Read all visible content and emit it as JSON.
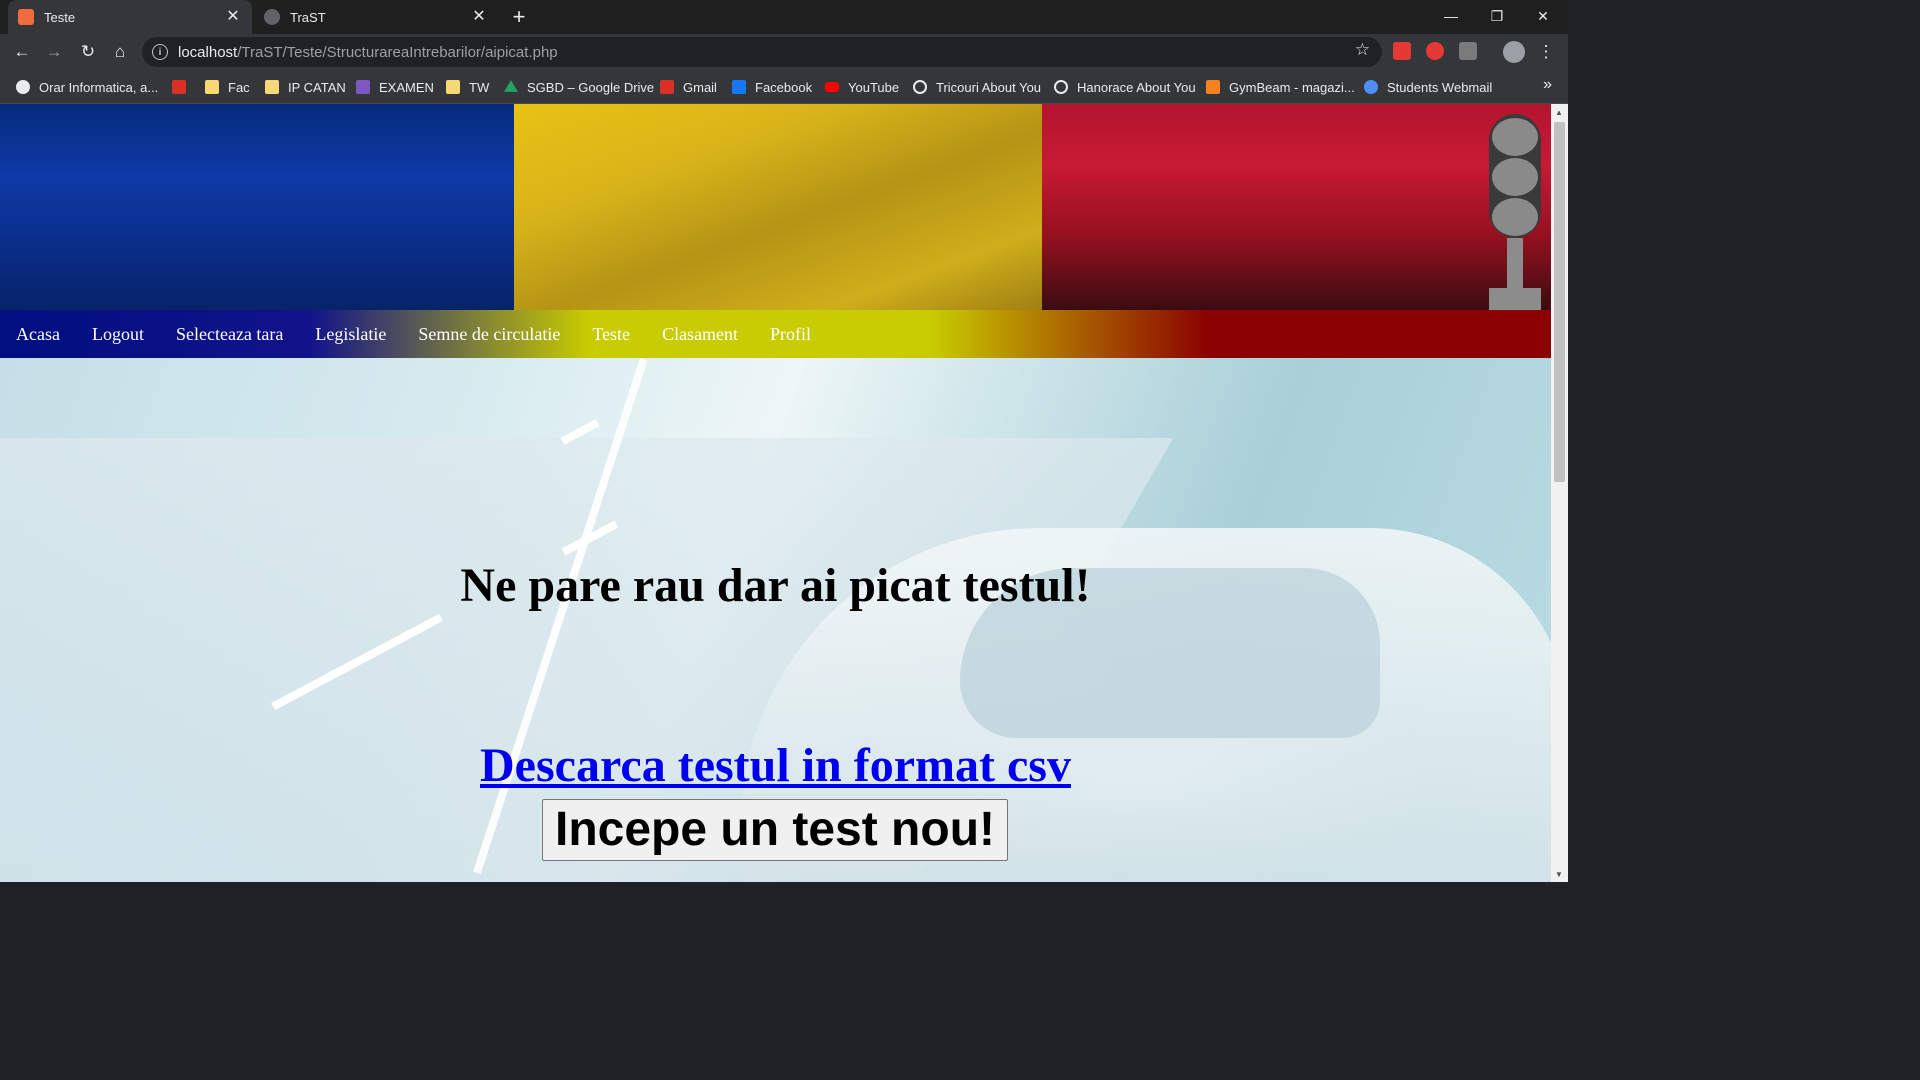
{
  "browser": {
    "tabs": [
      {
        "title": "Teste",
        "active": true,
        "favicon_color": "#f06c3c"
      },
      {
        "title": "TraST",
        "active": false,
        "favicon_color": "#5f6368"
      }
    ],
    "url": {
      "host": "localhost",
      "path": "/TraST/Teste/StructurareaIntrebarilor/aipicat.php"
    },
    "bookmarks": [
      {
        "label": "Orar Informatica, a...",
        "icon": "globe-icon",
        "color": "#e8eaed"
      },
      {
        "label": "",
        "icon": "gmail-icon",
        "color": "#d93025"
      },
      {
        "label": "Fac",
        "icon": "folder-icon",
        "color": "#f8d775"
      },
      {
        "label": "IP CATAN",
        "icon": "folder-icon",
        "color": "#f8d775"
      },
      {
        "label": "EXAMEN",
        "icon": "list-icon",
        "color": "#7e57c2"
      },
      {
        "label": "TW",
        "icon": "folder-icon",
        "color": "#f8d775"
      },
      {
        "label": "SGBD – Google Drive",
        "icon": "drive-icon",
        "color": "#1fa463"
      },
      {
        "label": "Gmail",
        "icon": "gmail-icon",
        "color": "#d93025"
      },
      {
        "label": "Facebook",
        "icon": "facebook-icon",
        "color": "#1877f2"
      },
      {
        "label": "YouTube",
        "icon": "youtube-icon",
        "color": "#ff0000"
      },
      {
        "label": "Tricouri About You",
        "icon": "circle-icon",
        "color": "#e8eaed"
      },
      {
        "label": "Hanorace About You",
        "icon": "circle-icon",
        "color": "#e8eaed"
      },
      {
        "label": "GymBeam - magazi...",
        "icon": "gymbeam-icon",
        "color": "#f5821f"
      },
      {
        "label": "Students Webmail",
        "icon": "webmail-icon",
        "color": "#4f8ef7"
      }
    ],
    "bookmarks_more": "»"
  },
  "site": {
    "menu": [
      "Acasa",
      "Logout",
      "Selecteaza tara",
      "Legislatie",
      "Semne de circulatie",
      "Teste",
      "Clasament",
      "Profil"
    ],
    "message": "Ne pare rau dar ai picat testul!",
    "download_link": "Descarca testul in format csv",
    "new_test_button": "Incepe un test nou!"
  },
  "colors": {
    "flag_blue": "#0e3aa8",
    "flag_yellow": "#d8b41a",
    "flag_red": "#c81a34",
    "link": "#0000ee"
  }
}
